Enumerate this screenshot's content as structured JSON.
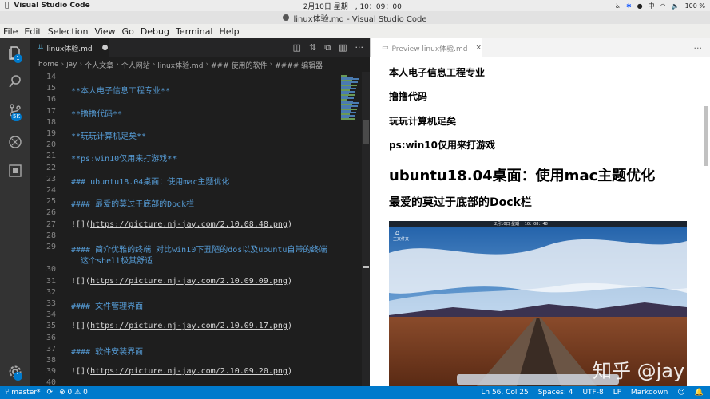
{
  "system_bar": {
    "app_name": "Visual Studio Code",
    "clock": "2月10日 星期一, 10：09：00",
    "input_method": "中",
    "battery": "100 %"
  },
  "window": {
    "title": "linux体验.md - Visual Studio Code"
  },
  "menu": [
    "File",
    "Edit",
    "Selection",
    "View",
    "Go",
    "Debug",
    "Terminal",
    "Help"
  ],
  "activity_bar": {
    "explorer_badge": "1",
    "scm_badge": "5K",
    "settings_badge": "1"
  },
  "editor": {
    "tab_label": "linux体验.md",
    "breadcrumb": [
      "home",
      "jay",
      "个人文章",
      "个人网站",
      "linux体验.md",
      "### 使用的软件",
      "#### 编辑器"
    ],
    "lines": [
      {
        "n": "14",
        "text": ""
      },
      {
        "n": "15",
        "text": "**本人电子信息工程专业**"
      },
      {
        "n": "16",
        "text": ""
      },
      {
        "n": "17",
        "text": "**撸撸代码**"
      },
      {
        "n": "18",
        "text": ""
      },
      {
        "n": "19",
        "text": "**玩玩计算机足矣**"
      },
      {
        "n": "20",
        "text": ""
      },
      {
        "n": "21",
        "text": "**ps:win10仅用来打游戏**"
      },
      {
        "n": "22",
        "text": ""
      },
      {
        "n": "23",
        "text": "### ubuntu18.04桌面：使用mac主题优化"
      },
      {
        "n": "24",
        "text": ""
      },
      {
        "n": "25",
        "text": "#### 最爱的莫过于底部的Dock栏"
      },
      {
        "n": "26",
        "text": ""
      },
      {
        "n": "27",
        "text": "![](https://picture.nj-jay.com/2.10.08.48.png)"
      },
      {
        "n": "28",
        "text": ""
      },
      {
        "n": "29",
        "text": "#### 简介优雅的终端 对比win10下丑陋的dos以及ubuntu自带的终端"
      },
      {
        "n": "",
        "text": "  这个shell极其舒适"
      },
      {
        "n": "30",
        "text": ""
      },
      {
        "n": "31",
        "text": "![](https://picture.nj-jay.com/2.10.09.09.png)"
      },
      {
        "n": "32",
        "text": ""
      },
      {
        "n": "33",
        "text": "#### 文件管理界面"
      },
      {
        "n": "34",
        "text": ""
      },
      {
        "n": "35",
        "text": "![](https://picture.nj-jay.com/2.10.09.17.png)"
      },
      {
        "n": "36",
        "text": ""
      },
      {
        "n": "37",
        "text": "#### 软件安装界面"
      },
      {
        "n": "38",
        "text": ""
      },
      {
        "n": "39",
        "text": "![](https://picture.nj-jay.com/2.10.09.20.png)"
      },
      {
        "n": "40",
        "text": ""
      }
    ]
  },
  "preview": {
    "tab_label": "Preview linux体验.md",
    "p1": "本人电子信息工程专业",
    "p2": "撸撸代码",
    "p3": "玩玩计算机足矣",
    "p4": "ps:win10仅用来打游戏",
    "h3": "ubuntu18.04桌面：使用mac主题优化",
    "h4": "最爱的莫过于底部的Dock栏",
    "embedded_image": {
      "date": "2月10日 星期一 10：08：48",
      "desktop_icon_label": "主文件夹",
      "watermark": "知乎 @jay"
    }
  },
  "status_bar": {
    "branch": "master*",
    "errors": "0",
    "warnings": "0",
    "cursor": "Ln 56, Col 25",
    "indent": "Spaces: 4",
    "encoding": "UTF-8",
    "eol": "LF",
    "language": "Markdown"
  },
  "colors": {
    "link": "#ce9178",
    "markdown_text": "#569cd6",
    "status_bar": "#007acc"
  }
}
